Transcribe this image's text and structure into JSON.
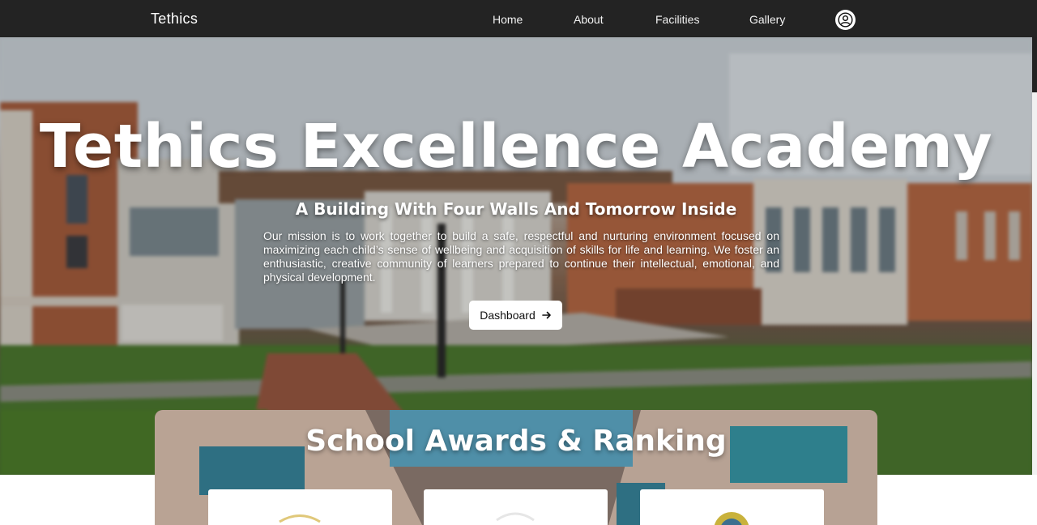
{
  "navbar": {
    "brand": "Tethics",
    "links": [
      "Home",
      "About",
      "Facilities",
      "Gallery"
    ],
    "profile_icon": "user-circle-icon"
  },
  "hero": {
    "title": "Tethics Excellence Academy",
    "subtitle": "A Building With Four Walls And Tomorrow Inside",
    "mission": "Our mission is to work together to build a safe, respectful and nurturing environment focused on maximizing each child’s sense of wellbeing and acquisition of skills for life and learning. We foster an enthusiastic, creative community of learners prepared to continue their intellectual, emotional, and physical development.",
    "button_label": "Dashboard",
    "button_icon": "arrow-right-icon"
  },
  "awards": {
    "title": "School Awards & Ranking",
    "cards": [
      "award-badge-1",
      "award-badge-2",
      "award-badge-3"
    ]
  }
}
